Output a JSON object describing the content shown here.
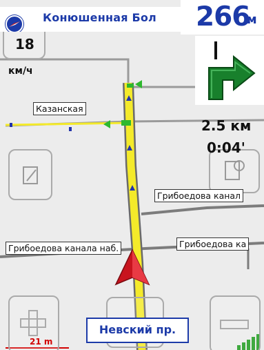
{
  "speed": {
    "value": "18",
    "unit": "км/ч"
  },
  "top_bar": {
    "street_name": "Конюшенная Бол",
    "distance_value": "266",
    "distance_unit": "м"
  },
  "trip": {
    "remaining_distance": "2.5 км",
    "remaining_time": "0:04'"
  },
  "map_labels": {
    "kazanskaya": "Казанская",
    "griboedova_right": "Грибоедова канал",
    "griboedova_left": "Грибоедова канала наб.",
    "griboedova_lower_right": "Грибоедова ка"
  },
  "bottom": {
    "current_street": "Невский пр.",
    "scale": "21 m"
  },
  "icons": {
    "compass": "compass-icon",
    "turn": "turn-right-arrow-icon",
    "position": "position-arrow-icon",
    "edit": "edit-icon",
    "search": "search-icon",
    "zoom_in": "plus-icon",
    "zoom_out": "minus-icon",
    "signal": "gps-signal-icon"
  },
  "colors": {
    "route": "#f4ea2a",
    "label_blue": "#1c3aa8",
    "turn_arrow": "#18802c",
    "position_arrow": "#c8141e",
    "scale": "#d20000"
  }
}
